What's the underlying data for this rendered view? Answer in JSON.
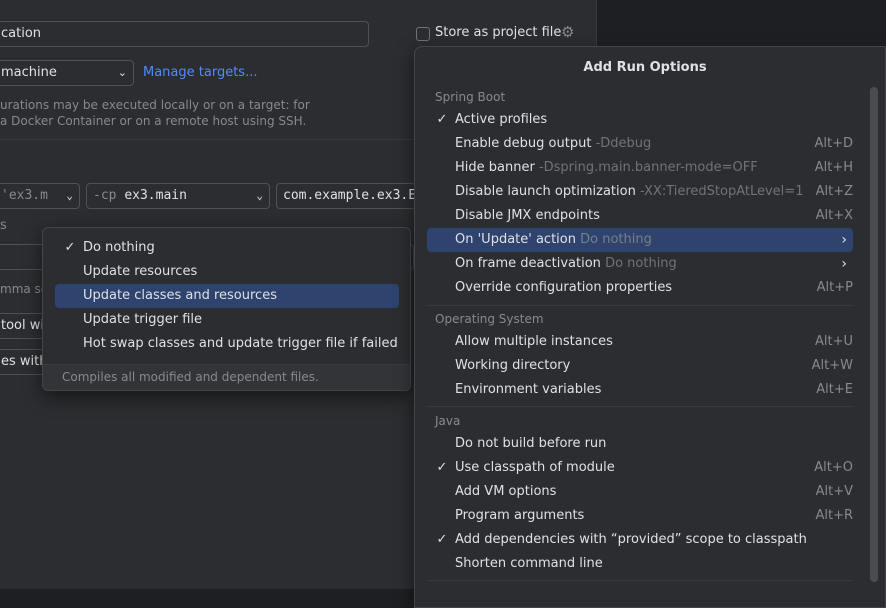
{
  "dialog": {
    "name_value": "cation",
    "store_label": "Store as project file",
    "target_value": "machine",
    "manage_targets": "Manage targets...",
    "info_line1": "urations may be executed locally or on a target: for",
    "info_line2": "a Docker Container or on a remote host using SSH.",
    "jre_value": "'ex3.m",
    "cp_flag": "-cp",
    "cp_value": "ex3.main",
    "main_class": "com.example.ex3.E",
    "cut_s": "s",
    "comma_hint": "mma se",
    "tool_label": "tool wi",
    "es_label": "es with"
  },
  "update_popup": {
    "items": [
      {
        "label": "Do nothing",
        "checked": true
      },
      {
        "label": "Update resources",
        "checked": false
      },
      {
        "label": "Update classes and resources",
        "checked": false,
        "selected": true
      },
      {
        "label": "Update trigger file",
        "checked": false
      },
      {
        "label": "Hot swap classes and update trigger file if failed",
        "checked": false
      }
    ],
    "footer": "Compiles all modified and dependent files."
  },
  "run_options": {
    "title": "Add Run Options",
    "groups": {
      "spring": "Spring Boot",
      "os": "Operating System",
      "java": "Java"
    },
    "spring_items": [
      {
        "label": "Active profiles",
        "desc": "",
        "shortcut": "",
        "checked": true
      },
      {
        "label": "Enable debug output",
        "desc": "-Ddebug",
        "shortcut": "Alt+D"
      },
      {
        "label": "Hide banner",
        "desc": "-Dspring.main.banner-mode=OFF",
        "shortcut": "Alt+H"
      },
      {
        "label": "Disable launch optimization",
        "desc": "-XX:TieredStopAtLevel=1",
        "shortcut": "Alt+Z"
      },
      {
        "label": "Disable JMX endpoints",
        "desc": "",
        "shortcut": "Alt+X"
      },
      {
        "label": "On 'Update' action",
        "desc": "Do nothing",
        "shortcut": "",
        "submenu": true,
        "selected": true
      },
      {
        "label": "On frame deactivation",
        "desc": "Do nothing",
        "shortcut": "",
        "submenu": true
      },
      {
        "label": "Override configuration properties",
        "desc": "",
        "shortcut": "Alt+P"
      }
    ],
    "os_items": [
      {
        "label": "Allow multiple instances",
        "shortcut": "Alt+U"
      },
      {
        "label": "Working directory",
        "shortcut": "Alt+W"
      },
      {
        "label": "Environment variables",
        "shortcut": "Alt+E"
      }
    ],
    "java_items": [
      {
        "label": "Do not build before run",
        "shortcut": ""
      },
      {
        "label": "Use classpath of module",
        "shortcut": "Alt+O",
        "checked": true
      },
      {
        "label": "Add VM options",
        "shortcut": "Alt+V"
      },
      {
        "label": "Program arguments",
        "shortcut": "Alt+R"
      },
      {
        "label": "Add dependencies with “provided” scope to classpath",
        "shortcut": "",
        "checked": true
      },
      {
        "label": "Shorten command line",
        "shortcut": ""
      }
    ],
    "check_glyph": "✓",
    "submenu_glyph": "›"
  }
}
